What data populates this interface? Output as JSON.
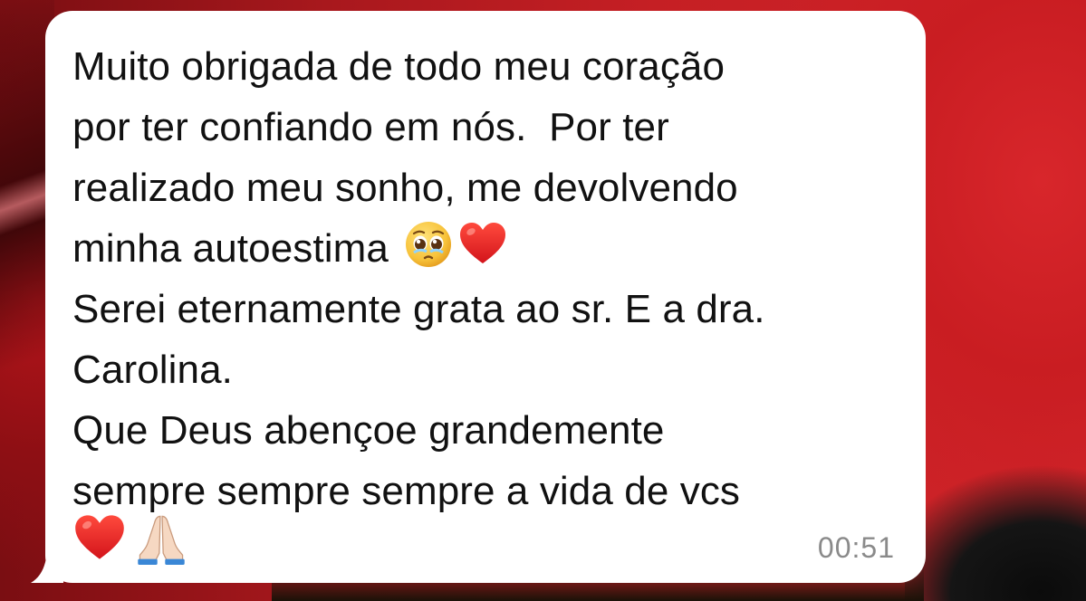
{
  "message": {
    "lines": [
      "Muito obrigada de todo meu coração",
      "por ter confiando em nós.  Por ter",
      "realizado meu sonho, me devolvendo",
      "minha autoestima",
      "Serei eternamente grata ao sr. E a dra.",
      "Carolina.",
      "Que Deus abençoe grandemente",
      "sempre sempre sempre a vida de vcs"
    ],
    "inline_emojis": [
      "pleading-face-emoji",
      "red-heart-emoji"
    ],
    "trailing_emojis": [
      "red-heart-emoji",
      "folded-hands-emoji"
    ],
    "timestamp": "00:51"
  },
  "colors": {
    "bubble": "#ffffff",
    "text": "#111111",
    "timestamp": "#8a8a8a",
    "wallpaper_accent": "#c91d22"
  }
}
